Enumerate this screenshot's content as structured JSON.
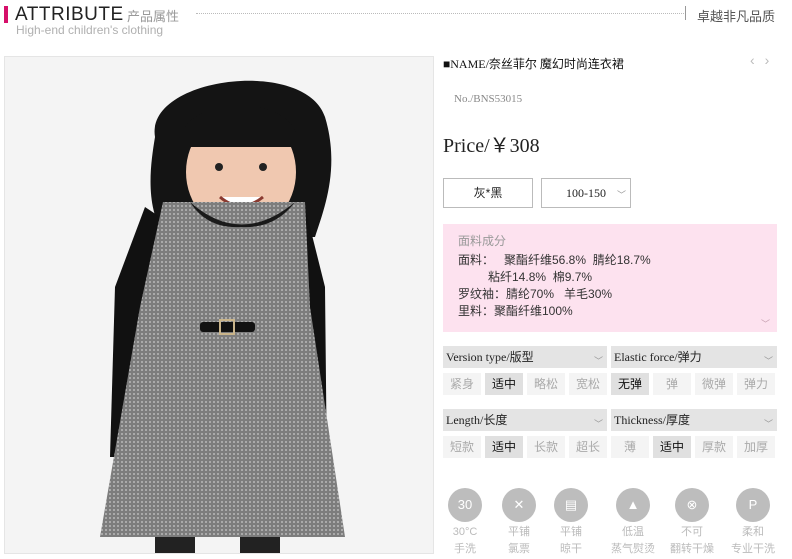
{
  "header": {
    "title": "ATTRIBUTE",
    "subtitle_cn": "产品属性",
    "tagline": "High-end children's clothing",
    "right_text": "卓越非凡品质"
  },
  "product": {
    "name": "■NAME/奈丝菲尔 魔幻时尚连衣裙",
    "number": "No./BNS53015",
    "price": "Price/￥308",
    "color": "灰*黑",
    "size": "100-150",
    "nav_prev": "‹",
    "nav_next": "›"
  },
  "fabric": {
    "title": "面料成分",
    "lines": [
      "面料：   聚酯纤维56.8%  腈纶18.7%",
      "         粘纤14.8%  棉9.7%",
      "罗纹袖：腈纶70%   羊毛30%",
      "里料：聚酯纤维100%"
    ]
  },
  "attributes": [
    {
      "label": "Version type/版型",
      "options": [
        "紧身",
        "适中",
        "略松",
        "宽松"
      ],
      "selected": 1
    },
    {
      "label": "Elastic force/弹力",
      "options": [
        "无弹",
        "弹",
        "微弹",
        "弹力"
      ],
      "selected": 0
    },
    {
      "label": "Length/长度",
      "options": [
        "短款",
        "适中",
        "长款",
        "超长"
      ],
      "selected": 1
    },
    {
      "label": "Thickness/厚度",
      "options": [
        "薄",
        "适中",
        "厚款",
        "加厚"
      ],
      "selected": 1
    }
  ],
  "care": [
    {
      "icon": "wash-30-icon",
      "glyph": "30",
      "label1": "30°C",
      "label2": "手洗"
    },
    {
      "icon": "no-bleach-icon",
      "glyph": "✕",
      "label1": "平铺",
      "label2": "氯票"
    },
    {
      "icon": "flat-dry-icon",
      "glyph": "▤",
      "label1": "平铺",
      "label2": "晾干"
    },
    {
      "icon": "iron-low-icon",
      "glyph": "▲",
      "label1": "低温",
      "label2": "蒸气熨烫"
    },
    {
      "icon": "no-tumble-dry-icon",
      "glyph": "⊗",
      "label1": "不可",
      "label2": "翻转干燥"
    },
    {
      "icon": "dry-clean-p-icon",
      "glyph": "P",
      "label1": "柔和",
      "label2": "专业干洗"
    }
  ]
}
